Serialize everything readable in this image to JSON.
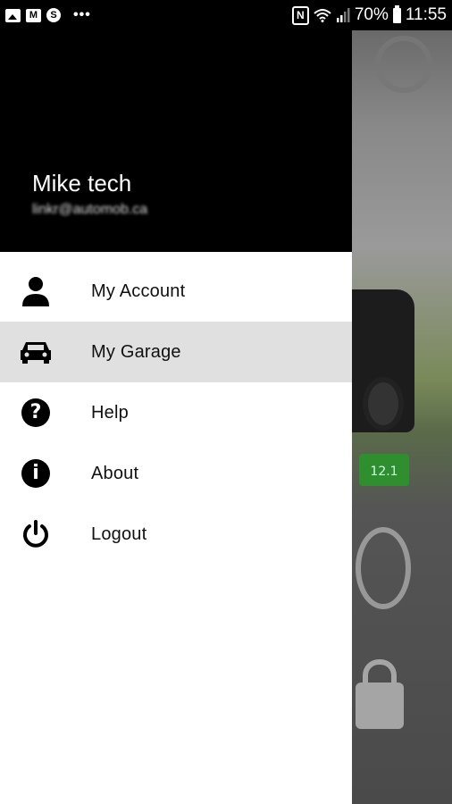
{
  "status_bar": {
    "battery": "70%",
    "time": "11:55",
    "notification_icons": [
      "gallery-icon",
      "gmail-icon",
      "skype-icon"
    ],
    "system_icons": [
      "nfc-icon",
      "wifi-icon",
      "signal-icon",
      "battery-icon"
    ]
  },
  "drawer": {
    "user_name": "Mike tech",
    "user_email": "linkr@automob.ca",
    "menu": [
      {
        "label": "My Account",
        "icon": "person-icon",
        "active": false
      },
      {
        "label": "My Garage",
        "icon": "car-icon",
        "active": true
      },
      {
        "label": "Help",
        "icon": "help-icon",
        "active": false
      },
      {
        "label": "About",
        "icon": "info-icon",
        "active": false
      },
      {
        "label": "Logout",
        "icon": "power-icon",
        "active": false
      }
    ]
  },
  "background_app": {
    "battery_voltage": "12.1",
    "icons": [
      "settings-gear-icon",
      "remote-start-icon",
      "unlock-icon"
    ]
  },
  "colors": {
    "header_bg": "#000000",
    "active_item_bg": "#e0e0e0",
    "battery_green": "#2f8f2f"
  }
}
